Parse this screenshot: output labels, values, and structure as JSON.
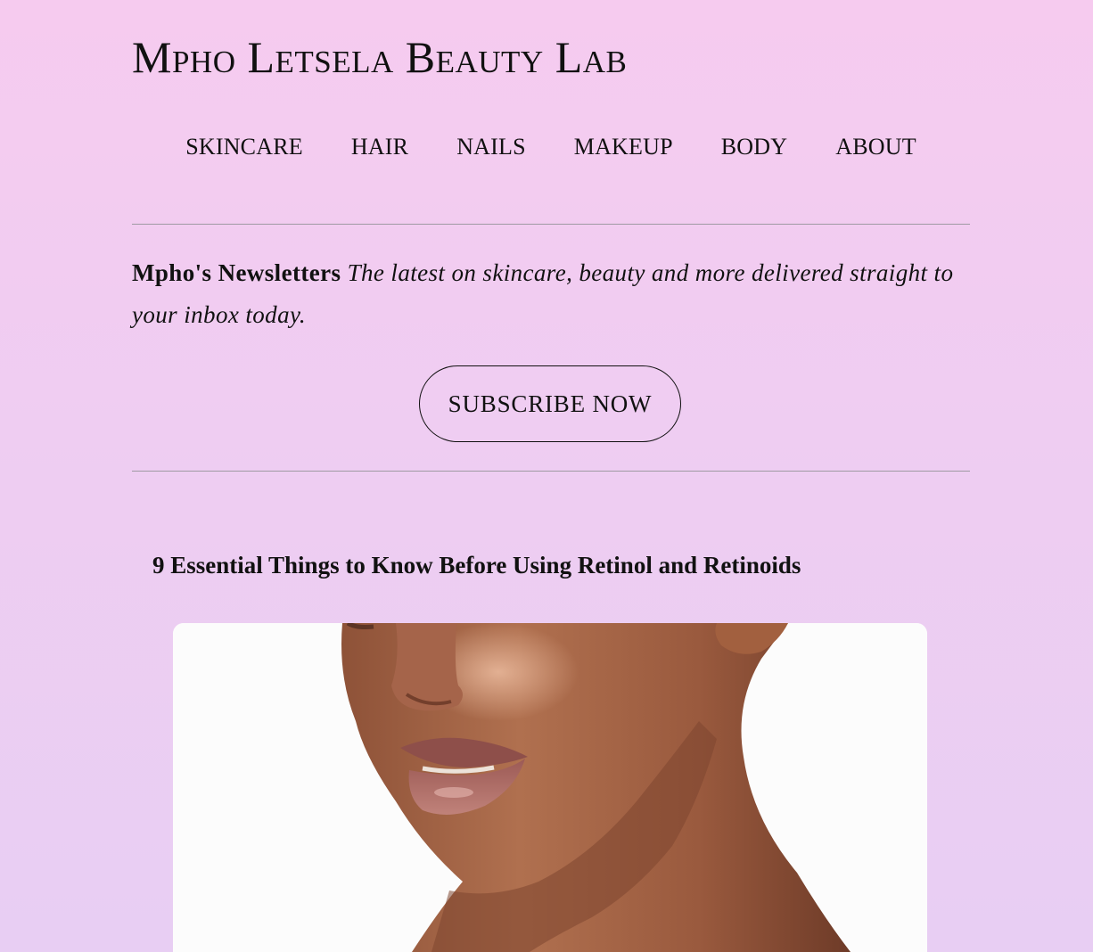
{
  "site": {
    "title": "Mpho Letsela Beauty Lab"
  },
  "nav": {
    "items": [
      {
        "label": "SKINCARE"
      },
      {
        "label": "HAIR"
      },
      {
        "label": "NAILS"
      },
      {
        "label": "MAKEUP"
      },
      {
        "label": "BODY"
      },
      {
        "label": "ABOUT"
      }
    ]
  },
  "newsletter": {
    "heading": "Mpho's Newsletters",
    "tagline": "The latest on skincare, beauty and more delivered straight to your inbox today.",
    "button_label": "SUBSCRIBE NOW"
  },
  "article": {
    "title": "9 Essential Things to Know Before Using Retinol and Retinoids",
    "image_subject": "woman-face-portrait"
  },
  "colors": {
    "background_top": "#f6cbef",
    "background_bottom": "#e8cef3",
    "text": "#111111",
    "divider": "#9e9aa3",
    "image_background": "#fcfcfc",
    "skin": "#a4654a",
    "lips": "#b0706a"
  }
}
